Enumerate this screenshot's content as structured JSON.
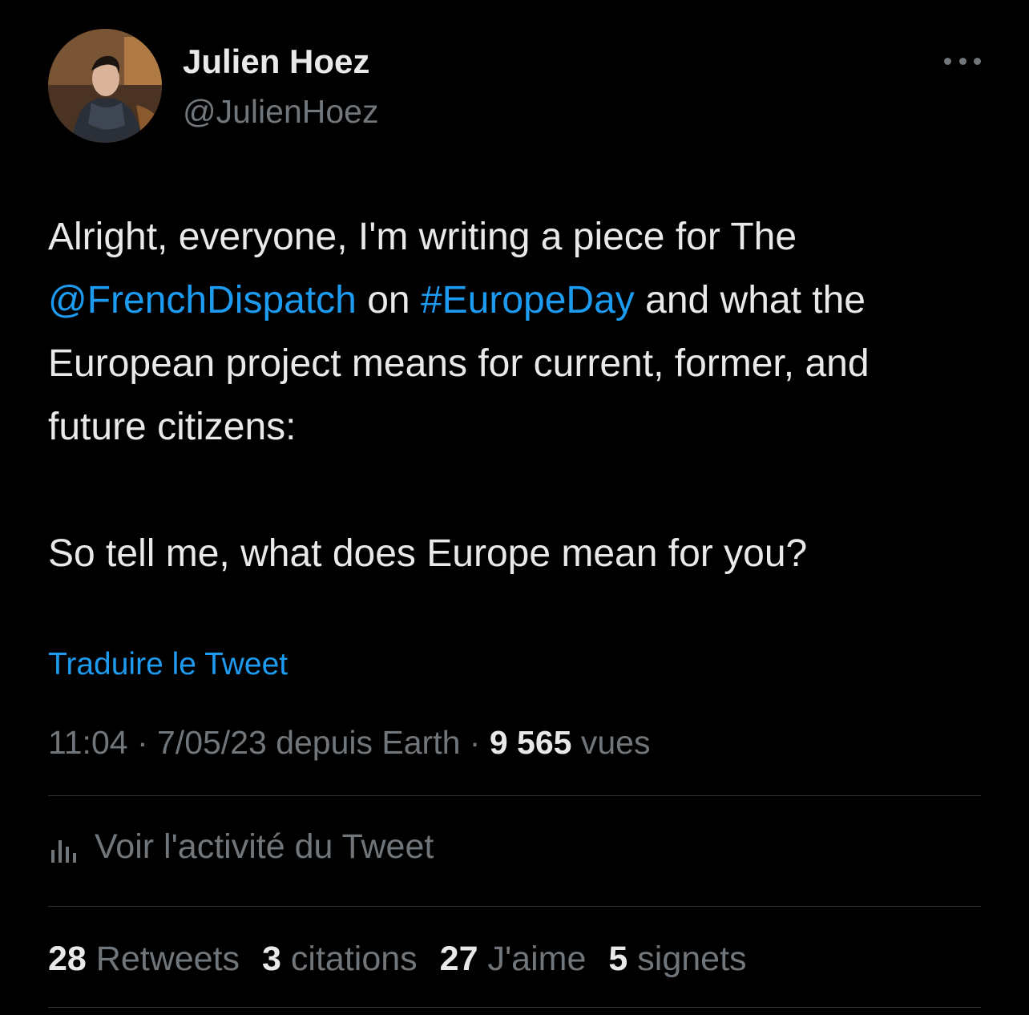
{
  "author": {
    "display_name": "Julien Hoez",
    "handle": "@JulienHoez"
  },
  "tweet": {
    "line1": "Alright, everyone, I'm writing a piece for The",
    "mention": "@FrenchDispatch",
    "on_word": " on ",
    "hashtag": "#EuropeDay",
    "after_hashtag": " and what the",
    "line3": "European project means for current, former, and",
    "line4": "future citizens:",
    "line5": "So tell me, what does Europe mean for you?"
  },
  "translate_label": "Traduire le Tweet",
  "meta": {
    "time": "11:04",
    "sep1": " · ",
    "date": "7/05/23",
    "source": " depuis Earth",
    "sep2": " · ",
    "views_count": "9 565",
    "views_label": " vues"
  },
  "activity_label": "Voir l'activité du Tweet",
  "stats": [
    {
      "num": "28",
      "label": "Retweets"
    },
    {
      "num": "3",
      "label": "citations"
    },
    {
      "num": "27",
      "label": "J'aime"
    },
    {
      "num": "5",
      "label": "signets"
    }
  ],
  "colors": {
    "background": "#000000",
    "text": "#e7e9ea",
    "secondary": "#71767b",
    "link": "#1d9bf0",
    "divider": "#2f3336"
  },
  "icons": {
    "more": "more-dots-icon",
    "activity": "bar-chart-icon"
  }
}
